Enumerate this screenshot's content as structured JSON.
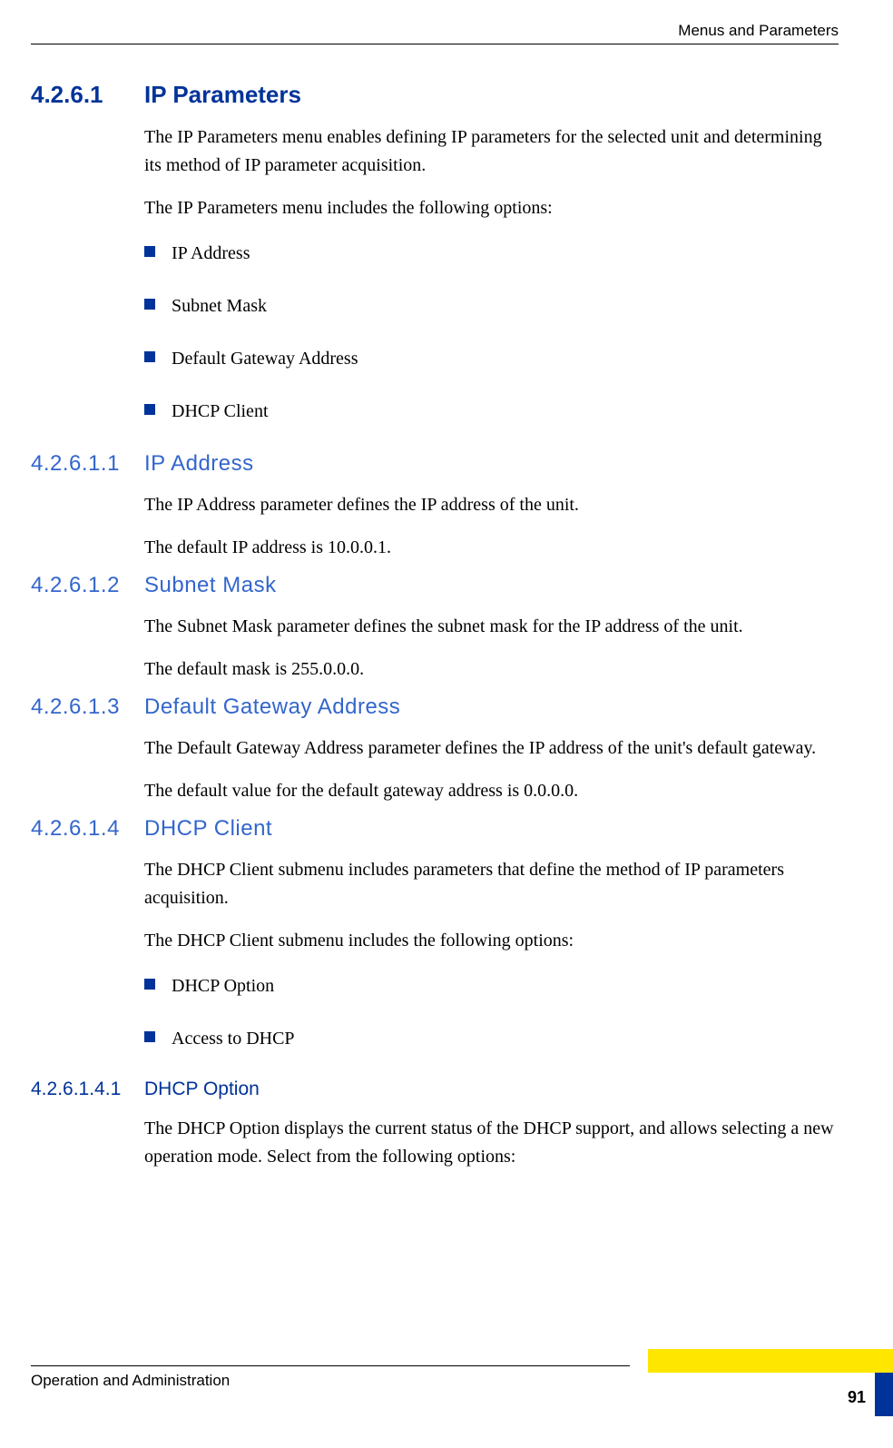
{
  "header": {
    "running_title": "Menus and Parameters"
  },
  "sections": {
    "s1": {
      "num": "4.2.6.1",
      "title": "IP Parameters"
    },
    "s1_p1": "The IP Parameters menu enables defining IP parameters for the selected unit and determining its method of IP parameter acquisition.",
    "s1_p2": "The IP Parameters menu includes the following options:",
    "s1_bullets": [
      "IP Address",
      "Subnet Mask",
      "Default Gateway Address",
      "DHCP Client"
    ],
    "s11": {
      "num": "4.2.6.1.1",
      "title": "IP Address"
    },
    "s11_p1": "The IP Address parameter defines the IP address of the unit.",
    "s11_p2": "The default IP address is 10.0.0.1.",
    "s12": {
      "num": "4.2.6.1.2",
      "title": "Subnet Mask"
    },
    "s12_p1": "The Subnet Mask parameter defines the subnet mask for the IP address of the unit.",
    "s12_p2": "The default mask is 255.0.0.0.",
    "s13": {
      "num": "4.2.6.1.3",
      "title": "Default Gateway Address"
    },
    "s13_p1": "The Default Gateway Address parameter defines the IP address of the unit's default gateway.",
    "s13_p2": "The default value for the default gateway address is 0.0.0.0.",
    "s14": {
      "num": "4.2.6.1.4",
      "title": "DHCP Client"
    },
    "s14_p1": "The DHCP Client submenu includes parameters that define the method of IP parameters acquisition.",
    "s14_p2": "The DHCP Client submenu includes the following options:",
    "s14_bullets": [
      "DHCP Option",
      "Access to DHCP"
    ],
    "s141": {
      "num": "4.2.6.1.4.1",
      "title": "DHCP Option"
    },
    "s141_p1": "The DHCP Option displays the current status of the DHCP support, and allows selecting a new operation mode. Select from the following options:"
  },
  "footer": {
    "doc_title": "Operation and Administration",
    "page_num": "91"
  }
}
